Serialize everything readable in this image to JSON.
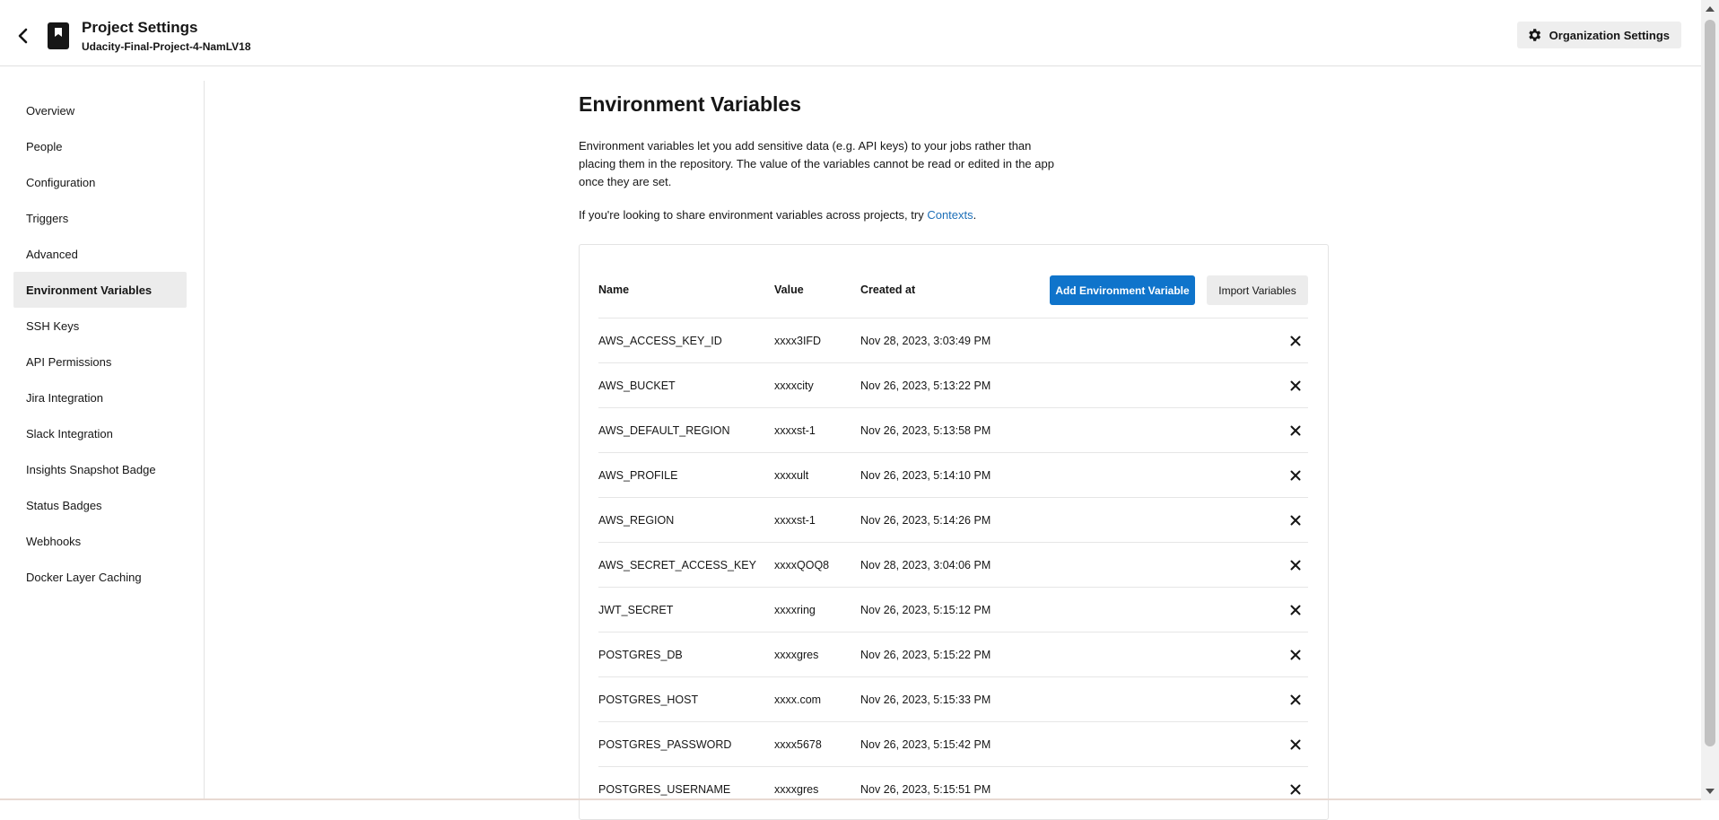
{
  "header": {
    "title": "Project Settings",
    "subtitle": "Udacity-Final-Project-4-NamLV18",
    "org_settings_label": "Organization Settings"
  },
  "sidebar": {
    "items": [
      {
        "label": "Overview"
      },
      {
        "label": "People"
      },
      {
        "label": "Configuration"
      },
      {
        "label": "Triggers"
      },
      {
        "label": "Advanced"
      },
      {
        "label": "Environment Variables",
        "active": true
      },
      {
        "label": "SSH Keys"
      },
      {
        "label": "API Permissions"
      },
      {
        "label": "Jira Integration"
      },
      {
        "label": "Slack Integration"
      },
      {
        "label": "Insights Snapshot Badge"
      },
      {
        "label": "Status Badges"
      },
      {
        "label": "Webhooks"
      },
      {
        "label": "Docker Layer Caching"
      }
    ]
  },
  "main": {
    "title": "Environment Variables",
    "description": "Environment variables let you add sensitive data (e.g. API keys) to your jobs rather than placing them in the repository. The value of the variables cannot be read or edited in the app once they are set.",
    "share_prefix": "If you're looking to share environment variables across projects, try ",
    "share_link": "Contexts",
    "share_suffix": "."
  },
  "table": {
    "headers": {
      "name": "Name",
      "value": "Value",
      "created": "Created at"
    },
    "add_button": "Add Environment Variable",
    "import_button": "Import Variables",
    "rows": [
      {
        "name": "AWS_ACCESS_KEY_ID",
        "value": "xxxx3IFD",
        "created": "Nov 28, 2023, 3:03:49 PM"
      },
      {
        "name": "AWS_BUCKET",
        "value": "xxxxcity",
        "created": "Nov 26, 2023, 5:13:22 PM"
      },
      {
        "name": "AWS_DEFAULT_REGION",
        "value": "xxxxst-1",
        "created": "Nov 26, 2023, 5:13:58 PM"
      },
      {
        "name": "AWS_PROFILE",
        "value": "xxxxult",
        "created": "Nov 26, 2023, 5:14:10 PM"
      },
      {
        "name": "AWS_REGION",
        "value": "xxxxst-1",
        "created": "Nov 26, 2023, 5:14:26 PM"
      },
      {
        "name": "AWS_SECRET_ACCESS_KEY",
        "value": "xxxxQOQ8",
        "created": "Nov 28, 2023, 3:04:06 PM"
      },
      {
        "name": "JWT_SECRET",
        "value": "xxxxring",
        "created": "Nov 26, 2023, 5:15:12 PM"
      },
      {
        "name": "POSTGRES_DB",
        "value": "xxxxgres",
        "created": "Nov 26, 2023, 5:15:22 PM"
      },
      {
        "name": "POSTGRES_HOST",
        "value": "xxxx.com",
        "created": "Nov 26, 2023, 5:15:33 PM"
      },
      {
        "name": "POSTGRES_PASSWORD",
        "value": "xxxx5678",
        "created": "Nov 26, 2023, 5:15:42 PM"
      },
      {
        "name": "POSTGRES_USERNAME",
        "value": "xxxxgres",
        "created": "Nov 26, 2023, 5:15:51 PM"
      }
    ]
  },
  "icons": {
    "back": "chevron-left-icon",
    "project": "bookmark-icon",
    "settings": "gear-icon",
    "delete": "close-icon"
  },
  "colors": {
    "accent": "#0f74cb",
    "link": "#1d6fb8",
    "active_bg": "#ececec"
  }
}
